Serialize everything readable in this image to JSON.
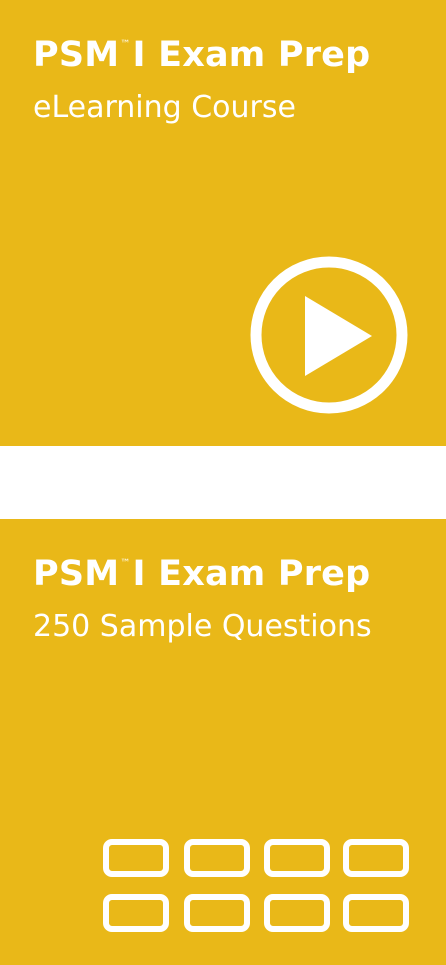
{
  "tiles": [
    {
      "title_main": "PSM",
      "title_tm": "™",
      "title_rest": "I Exam Prep",
      "subtitle": "eLearning Course",
      "icon": "play-circle-icon",
      "color": "#e9b818"
    },
    {
      "title_main": "PSM",
      "title_tm": "™",
      "title_rest": "I Exam Prep",
      "subtitle": "250 Sample Questions",
      "icon": "question-grid-icon",
      "color": "#e9b818"
    }
  ]
}
